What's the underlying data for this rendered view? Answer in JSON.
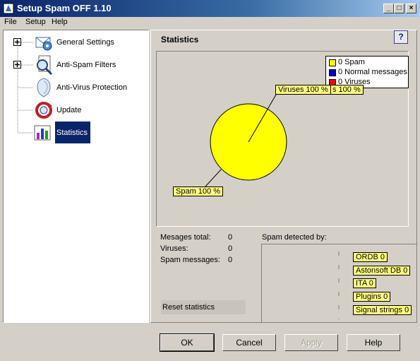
{
  "window": {
    "title": "Setup Spam OFF 1.10"
  },
  "menu": [
    "File",
    "Setup",
    "Help"
  ],
  "tree": [
    {
      "label": "General Settings",
      "expandable": true,
      "icon": "gear-envelope-icon"
    },
    {
      "label": "Anti-Spam Filters",
      "expandable": true,
      "icon": "magnifier-document-icon"
    },
    {
      "label": "Anti-Virus Protection",
      "expandable": false,
      "icon": "shield-icon"
    },
    {
      "label": "Update",
      "expandable": false,
      "icon": "update-icon"
    },
    {
      "label": "Statistics",
      "expandable": false,
      "selected": true,
      "icon": "statistics-icon"
    }
  ],
  "page": {
    "heading": "Statistics",
    "help": "?"
  },
  "chart_data": {
    "type": "pie",
    "labels": [
      "Spam",
      "Normal messages",
      "Viruses"
    ],
    "values": [
      0,
      0,
      0
    ],
    "colors": [
      "#ffff00",
      "#0000c0",
      "#ff0000"
    ],
    "legend": [
      "0 Spam",
      "0 Normal messages",
      "0 Viruses"
    ],
    "callouts": [
      "Viruses 100 %",
      "s 100 %",
      "Spam 100 %"
    ],
    "legend_position": "top-right"
  },
  "stats": [
    {
      "label": "Mesages total:",
      "value": "0"
    },
    {
      "label": "Viruses:",
      "value": "0"
    },
    {
      "label": "Spam messages:",
      "value": "0"
    }
  ],
  "spam_detected": {
    "title": "Spam detected by:",
    "items": [
      "ORDB 0",
      "Astonsoft DB 0",
      "ITA 0",
      "Plugins 0",
      "Signal strings 0"
    ]
  },
  "reset_label": "Reset statistics",
  "buttons": {
    "ok": "OK",
    "cancel": "Cancel",
    "apply": "Apply",
    "help": "Help"
  },
  "colors": {
    "titlebar": "#0a246a",
    "selection": "#0a246a",
    "callout": "#ffff80"
  }
}
